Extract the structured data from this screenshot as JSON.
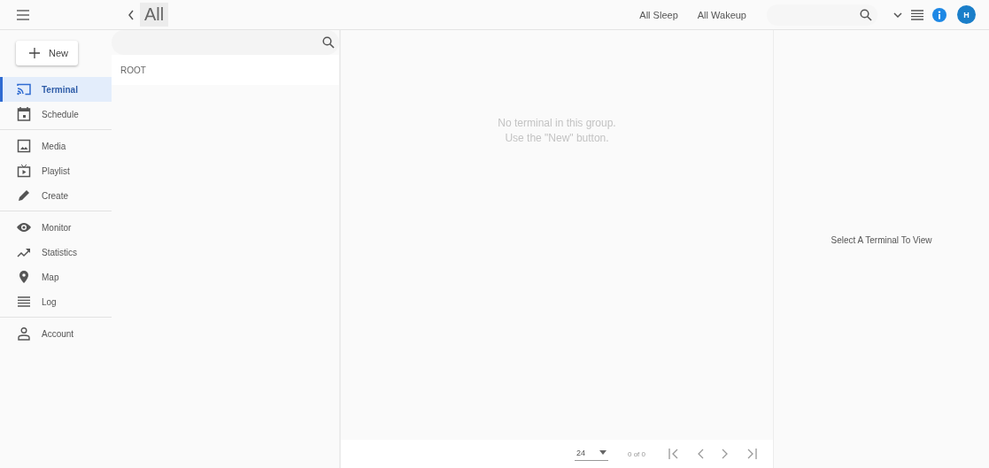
{
  "header": {
    "title": "All",
    "actions": [
      "All Sleep",
      "All Wakeup"
    ],
    "avatar": "H"
  },
  "new_button": "New",
  "sidebar": {
    "groups": [
      {
        "items": [
          {
            "label": "Terminal",
            "selected": true
          },
          {
            "label": "Schedule",
            "selected": false
          }
        ]
      },
      {
        "items": [
          {
            "label": "Media",
            "selected": false
          },
          {
            "label": "Playlist",
            "selected": false
          },
          {
            "label": "Create",
            "selected": false
          }
        ]
      },
      {
        "items": [
          {
            "label": "Monitor",
            "selected": false
          },
          {
            "label": "Statistics",
            "selected": false
          },
          {
            "label": "Map",
            "selected": false
          },
          {
            "label": "Log",
            "selected": false
          }
        ]
      },
      {
        "items": [
          {
            "label": "Account",
            "selected": false
          }
        ]
      }
    ]
  },
  "tree": {
    "items": [
      {
        "label": "ROOT"
      }
    ]
  },
  "terminal_list": {
    "empty_message": [
      "No terminal in this group.",
      "Use the \"New\" button."
    ],
    "pagination": {
      "page_size": "24",
      "range": "0 of 0"
    }
  },
  "detail": {
    "empty_message": "Select A Terminal To View"
  }
}
